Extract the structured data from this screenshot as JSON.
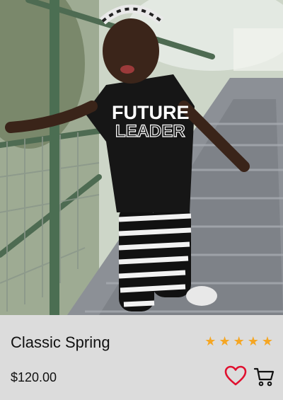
{
  "product": {
    "title": "Classic Spring",
    "price": "$120.00",
    "rating": 5,
    "rating_max": 5,
    "shirt_text_line1": "FUTURE",
    "shirt_text_line2": "LEADER",
    "image_subject": "child-on-bridge-photo"
  },
  "actions": {
    "favorite_icon": "heart-icon",
    "cart_icon": "cart-icon"
  },
  "colors": {
    "star": "#f5a623",
    "heart": "#e0102f",
    "panel_bg": "#dcdcdc",
    "text": "#111111"
  }
}
